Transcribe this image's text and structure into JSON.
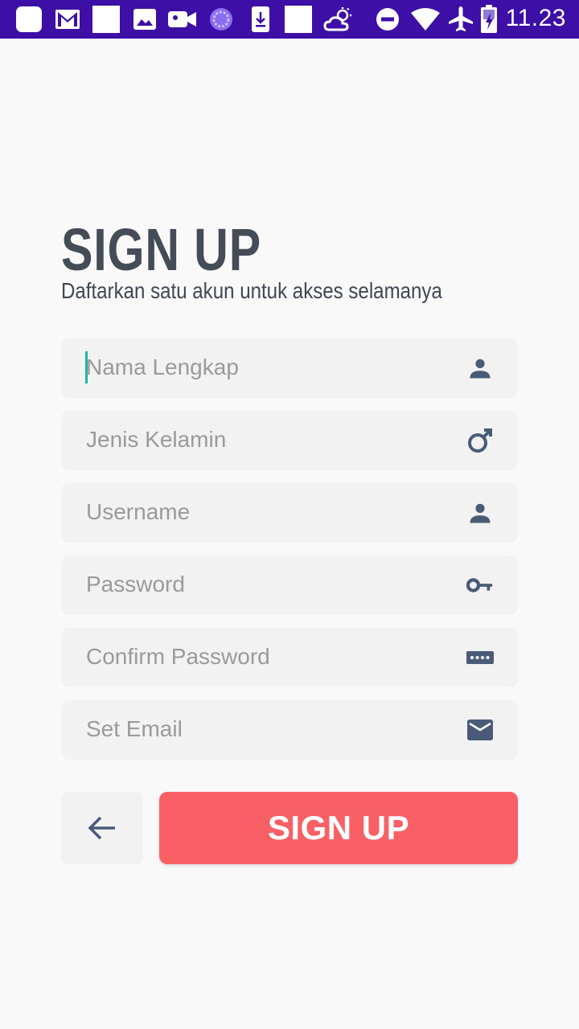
{
  "status_bar": {
    "time": "11.23",
    "icons": [
      "app-icon",
      "gmail-icon",
      "blank-icon",
      "photo-icon",
      "video-icon",
      "circle-app-icon",
      "download-icon",
      "blank-icon-2",
      "weather-icon",
      "do-not-disturb-icon",
      "wifi-icon",
      "airplane-icon",
      "battery-icon"
    ],
    "background": "#3d0fa6"
  },
  "header": {
    "title": "SIGN UP",
    "subtitle": "Daftarkan satu akun untuk akses selamanya"
  },
  "form": {
    "fields": [
      {
        "placeholder": "Nama Lengkap",
        "icon": "person-icon",
        "focused": true
      },
      {
        "placeholder": "Jenis Kelamin",
        "icon": "male-icon"
      },
      {
        "placeholder": "Username",
        "icon": "person-icon"
      },
      {
        "placeholder": "Password",
        "icon": "key-icon"
      },
      {
        "placeholder": "Confirm Password",
        "icon": "password-dots-icon"
      },
      {
        "placeholder": "Set Email",
        "icon": "mail-icon"
      }
    ]
  },
  "actions": {
    "back_icon": "arrow-left-icon",
    "signup_label": "SIGN UP",
    "signup_color": "#f86065"
  },
  "colors": {
    "icon": "#4a5b78",
    "title": "#444c58",
    "cursor": "#1fb3a6"
  }
}
